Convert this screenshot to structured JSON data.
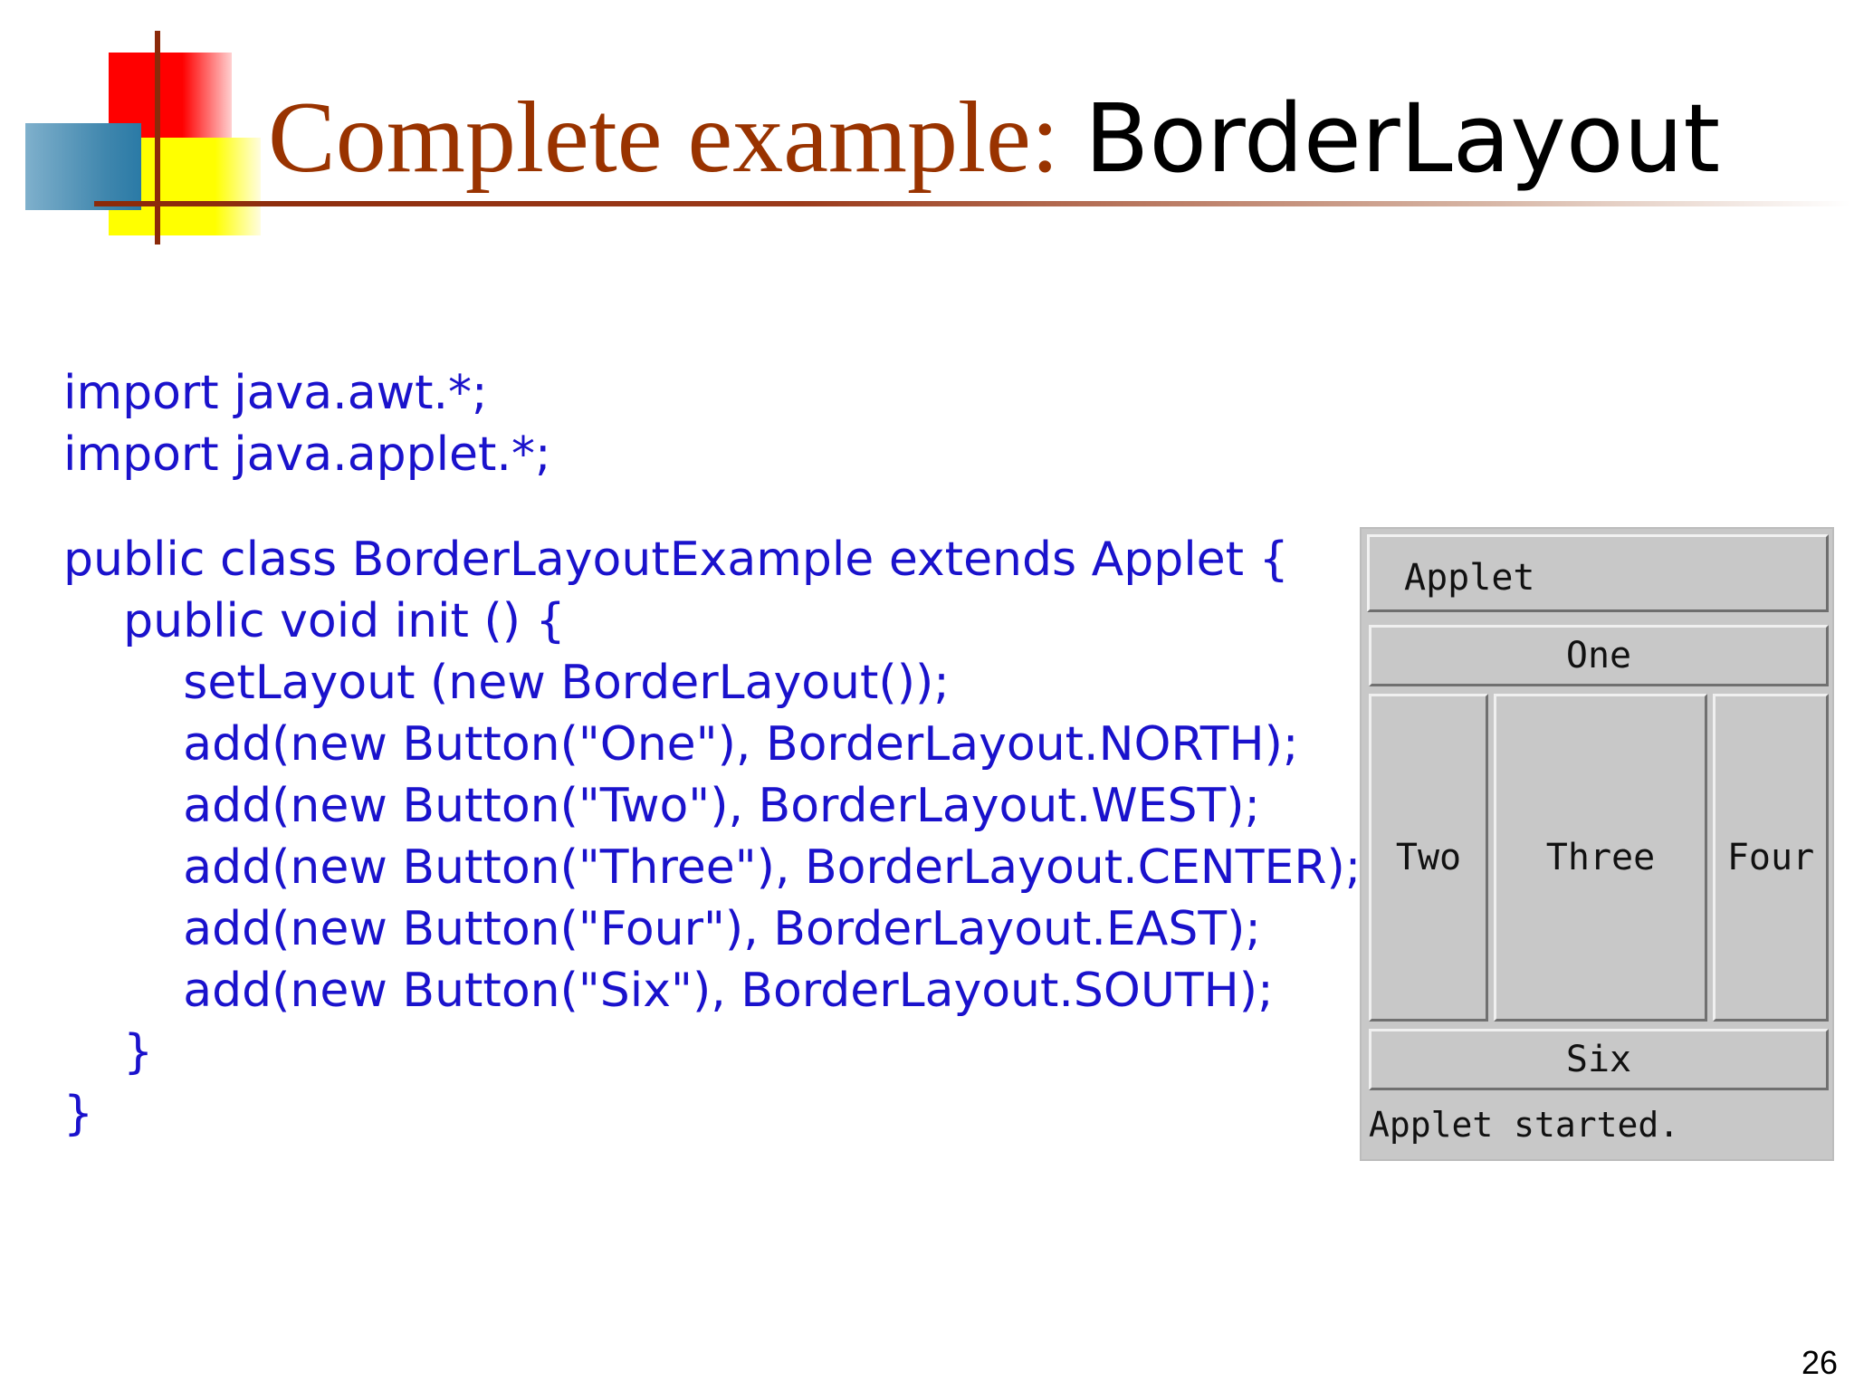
{
  "slide": {
    "title_part1": "Complete example: ",
    "title_part2": "BorderLayout",
    "page_number": "26"
  },
  "code": {
    "import_lines": [
      "import java.awt.*;",
      "import java.applet.*;"
    ],
    "class_lines": [
      "public class BorderLayoutExample extends Applet {",
      "    public void init () {",
      "        setLayout (new BorderLayout());",
      "        add(new Button(\"One\"), BorderLayout.NORTH);",
      "        add(new Button(\"Two\"), BorderLayout.WEST);",
      "        add(new Button(\"Three\"), BorderLayout.CENTER);",
      "        add(new Button(\"Four\"), BorderLayout.EAST);",
      "        add(new Button(\"Six\"), BorderLayout.SOUTH);",
      "    }",
      "}"
    ]
  },
  "applet": {
    "title": "Applet",
    "buttons": {
      "north": "One",
      "west": "Two",
      "center": "Three",
      "east": "Four",
      "south": "Six"
    },
    "status": "Applet started."
  },
  "colors": {
    "title_serif": "#993300",
    "code": "#1a12cc",
    "applet_bg": "#c8c8c8"
  }
}
